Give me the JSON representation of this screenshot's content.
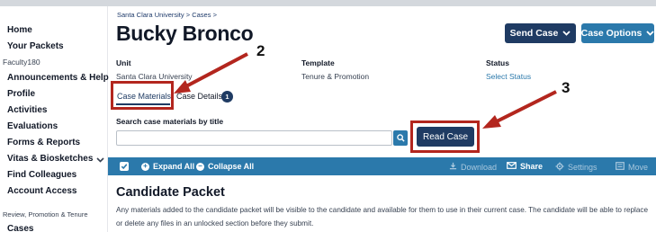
{
  "sidebar": {
    "items": [
      {
        "label": "Home",
        "type": "item"
      },
      {
        "label": "Your Packets",
        "type": "item"
      },
      {
        "label": "Faculty180",
        "type": "section"
      },
      {
        "label": "Announcements & Help",
        "type": "item"
      },
      {
        "label": "Profile",
        "type": "item"
      },
      {
        "label": "Activities",
        "type": "item"
      },
      {
        "label": "Evaluations",
        "type": "item"
      },
      {
        "label": "Forms & Reports",
        "type": "item"
      },
      {
        "label": "Vitas & Biosketches",
        "type": "item",
        "expandable": true
      },
      {
        "label": "Find Colleagues",
        "type": "item"
      },
      {
        "label": "Account Access",
        "type": "item"
      },
      {
        "label": "Review, Promotion & Tenure",
        "type": "section"
      },
      {
        "label": "Cases",
        "type": "item"
      }
    ]
  },
  "breadcrumb": {
    "parts": [
      "Santa Clara University",
      ">",
      "Cases",
      ">"
    ]
  },
  "page": {
    "title": "Bucky Bronco"
  },
  "header_buttons": {
    "send_case": "Send Case",
    "case_options": "Case Options"
  },
  "meta": {
    "unit_label": "Unit",
    "unit_value": "Santa Clara University",
    "template_label": "Template",
    "template_value": "Tenure & Promotion",
    "status_label": "Status",
    "status_value": "Select Status"
  },
  "tabs": [
    {
      "label": "Case Materials",
      "active": true
    },
    {
      "label": "Case Details",
      "badge": "1"
    }
  ],
  "search": {
    "label": "Search case materials by title",
    "value": "",
    "placeholder": ""
  },
  "read_case": {
    "label": "Read Case"
  },
  "toolbar": {
    "expand_all": "Expand All",
    "collapse_all": "Collapse All",
    "download": "Download",
    "share": "Share",
    "settings": "Settings",
    "move": "Move"
  },
  "section": {
    "title": "Candidate Packet",
    "description": "Any materials added to the candidate packet will be visible to the candidate and available for them to use in their current case. The candidate will be able to replace or delete any files in an unlocked section before they submit."
  },
  "annotations": {
    "labels": [
      "2",
      "3"
    ],
    "color": "#b3261e"
  },
  "colors": {
    "navy": "#1f3b63",
    "teal": "#2b79ab",
    "annotation_red": "#b3261e"
  }
}
